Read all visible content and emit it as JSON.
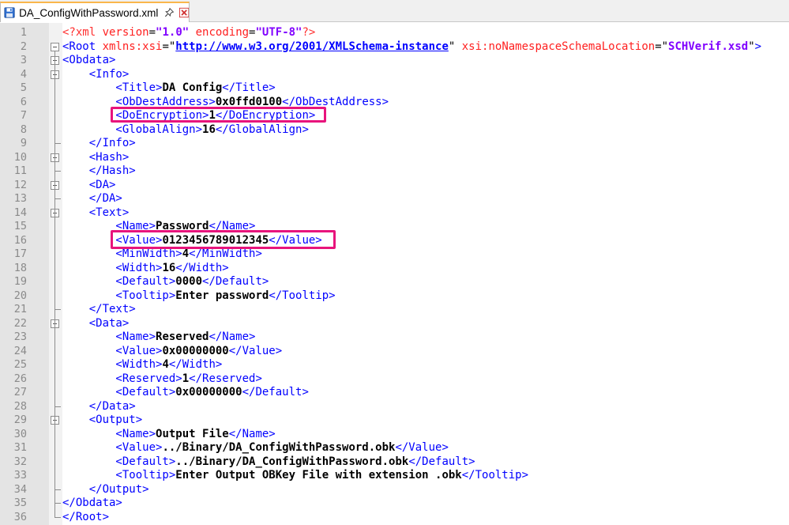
{
  "tab": {
    "title": "DA_ConfigWithPassword.xml"
  },
  "icons": {
    "file": "save-disk-icon",
    "pin": "pin-icon",
    "close": "close-icon"
  },
  "colors": {
    "highlight": "#e8147c",
    "tag": "#0000ff",
    "attribute": "#ff2020",
    "attribute_value": "#8000ff"
  },
  "lines": [
    {
      "n": "1",
      "parts": [
        [
          "pi",
          "<?xml "
        ],
        [
          "attr",
          "version"
        ],
        [
          "eq",
          "="
        ],
        [
          "aval",
          "\"1.0\""
        ],
        [
          "attr",
          " encoding"
        ],
        [
          "eq",
          "="
        ],
        [
          "aval",
          "\"UTF-8\""
        ],
        [
          "pi",
          "?>"
        ]
      ]
    },
    {
      "n": "2",
      "parts": [
        [
          "tag",
          "<Root "
        ],
        [
          "attr",
          "xmlns:xsi"
        ],
        [
          "eq",
          "=\""
        ],
        [
          "url",
          "http://www.w3.org/2001/XMLSchema-instance"
        ],
        [
          "eq",
          "\""
        ],
        [
          "attr",
          " xsi:noNamespaceSchemaLocation"
        ],
        [
          "eq",
          "=\""
        ],
        [
          "aval",
          "SCHVerif.xsd"
        ],
        [
          "eq",
          "\""
        ],
        [
          "tag",
          ">"
        ]
      ]
    },
    {
      "n": "3",
      "parts": [
        [
          "tag",
          "<Obdata>"
        ]
      ]
    },
    {
      "n": "4",
      "parts": [
        [
          "tag",
          "    <Info>"
        ]
      ]
    },
    {
      "n": "5",
      "parts": [
        [
          "tag",
          "        <Title>"
        ],
        [
          "val",
          "DA Config"
        ],
        [
          "tag",
          "</Title>"
        ]
      ]
    },
    {
      "n": "6",
      "parts": [
        [
          "tag",
          "        <ObDestAddress>"
        ],
        [
          "val",
          "0x0ffd0100"
        ],
        [
          "tag",
          "</ObDestAddress>"
        ]
      ]
    },
    {
      "n": "7",
      "parts": [
        [
          "tag",
          "        <DoEncryption>"
        ],
        [
          "val",
          "1"
        ],
        [
          "tag",
          "</DoEncryption>"
        ]
      ]
    },
    {
      "n": "8",
      "parts": [
        [
          "tag",
          "        <GlobalAlign>"
        ],
        [
          "val",
          "16"
        ],
        [
          "tag",
          "</GlobalAlign>"
        ]
      ]
    },
    {
      "n": "9",
      "parts": [
        [
          "tag",
          "    </Info>"
        ]
      ]
    },
    {
      "n": "10",
      "parts": [
        [
          "tag",
          "    <Hash>"
        ]
      ]
    },
    {
      "n": "11",
      "parts": [
        [
          "tag",
          "    </Hash>"
        ]
      ]
    },
    {
      "n": "12",
      "parts": [
        [
          "tag",
          "    <DA>"
        ]
      ]
    },
    {
      "n": "13",
      "parts": [
        [
          "tag",
          "    </DA>"
        ]
      ]
    },
    {
      "n": "14",
      "parts": [
        [
          "tag",
          "    <Text>"
        ]
      ]
    },
    {
      "n": "15",
      "parts": [
        [
          "tag",
          "        <Name>"
        ],
        [
          "val",
          "Password"
        ],
        [
          "tag",
          "</Name>"
        ]
      ]
    },
    {
      "n": "16",
      "parts": [
        [
          "tag",
          "        <Value>"
        ],
        [
          "val",
          "0123456789012345"
        ],
        [
          "tag",
          "</Value>"
        ]
      ]
    },
    {
      "n": "17",
      "parts": [
        [
          "tag",
          "        <MinWidth>"
        ],
        [
          "val",
          "4"
        ],
        [
          "tag",
          "</MinWidth>"
        ]
      ]
    },
    {
      "n": "18",
      "parts": [
        [
          "tag",
          "        <Width>"
        ],
        [
          "val",
          "16"
        ],
        [
          "tag",
          "</Width>"
        ]
      ]
    },
    {
      "n": "19",
      "parts": [
        [
          "tag",
          "        <Default>"
        ],
        [
          "val",
          "0000"
        ],
        [
          "tag",
          "</Default>"
        ]
      ]
    },
    {
      "n": "20",
      "parts": [
        [
          "tag",
          "        <Tooltip>"
        ],
        [
          "val",
          "Enter password"
        ],
        [
          "tag",
          "</Tooltip>"
        ]
      ]
    },
    {
      "n": "21",
      "parts": [
        [
          "tag",
          "    </Text>"
        ]
      ]
    },
    {
      "n": "22",
      "parts": [
        [
          "tag",
          "    <Data>"
        ]
      ]
    },
    {
      "n": "23",
      "parts": [
        [
          "tag",
          "        <Name>"
        ],
        [
          "val",
          "Reserved"
        ],
        [
          "tag",
          "</Name>"
        ]
      ]
    },
    {
      "n": "24",
      "parts": [
        [
          "tag",
          "        <Value>"
        ],
        [
          "val",
          "0x00000000"
        ],
        [
          "tag",
          "</Value>"
        ]
      ]
    },
    {
      "n": "25",
      "parts": [
        [
          "tag",
          "        <Width>"
        ],
        [
          "val",
          "4"
        ],
        [
          "tag",
          "</Width>"
        ]
      ]
    },
    {
      "n": "26",
      "parts": [
        [
          "tag",
          "        <Reserved>"
        ],
        [
          "val",
          "1"
        ],
        [
          "tag",
          "</Reserved>"
        ]
      ]
    },
    {
      "n": "27",
      "parts": [
        [
          "tag",
          "        <Default>"
        ],
        [
          "val",
          "0x00000000"
        ],
        [
          "tag",
          "</Default>"
        ]
      ]
    },
    {
      "n": "28",
      "parts": [
        [
          "tag",
          "    </Data>"
        ]
      ]
    },
    {
      "n": "29",
      "parts": [
        [
          "tag",
          "    <Output>"
        ]
      ]
    },
    {
      "n": "30",
      "parts": [
        [
          "tag",
          "        <Name>"
        ],
        [
          "val",
          "Output File"
        ],
        [
          "tag",
          "</Name>"
        ]
      ]
    },
    {
      "n": "31",
      "parts": [
        [
          "tag",
          "        <Value>"
        ],
        [
          "val",
          "../Binary/DA_ConfigWithPassword.obk"
        ],
        [
          "tag",
          "</Value>"
        ]
      ]
    },
    {
      "n": "32",
      "parts": [
        [
          "tag",
          "        <Default>"
        ],
        [
          "val",
          "../Binary/DA_ConfigWithPassword.obk"
        ],
        [
          "tag",
          "</Default>"
        ]
      ]
    },
    {
      "n": "33",
      "parts": [
        [
          "tag",
          "        <Tooltip>"
        ],
        [
          "val",
          "Enter Output OBKey File with extension .obk"
        ],
        [
          "tag",
          "</Tooltip>"
        ]
      ]
    },
    {
      "n": "34",
      "parts": [
        [
          "tag",
          "    </Output>"
        ]
      ]
    },
    {
      "n": "35",
      "parts": [
        [
          "tag",
          "</Obdata>"
        ]
      ]
    },
    {
      "n": "36",
      "parts": [
        [
          "tag",
          "</Root>"
        ]
      ]
    }
  ]
}
